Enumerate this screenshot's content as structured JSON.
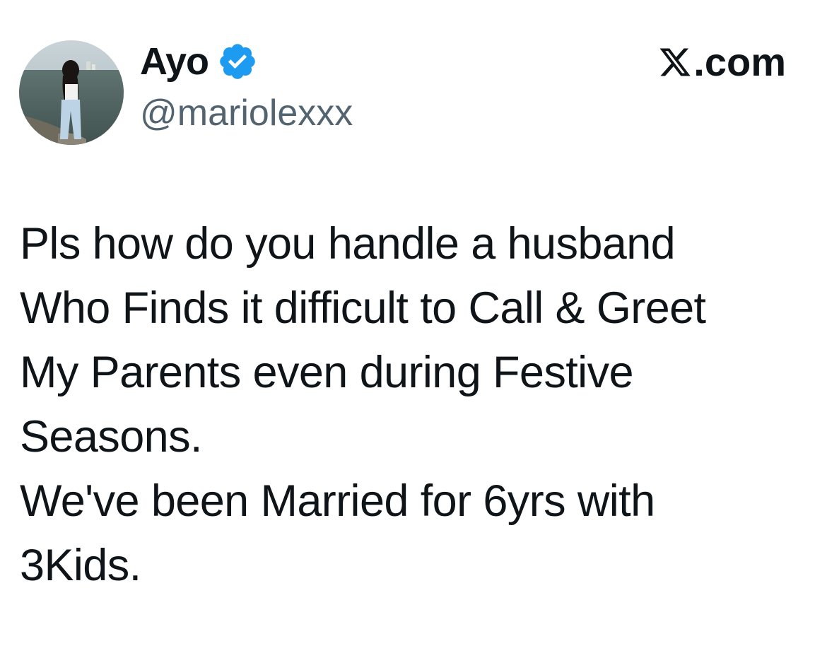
{
  "author": {
    "display_name": "Ayo",
    "handle": "@mariolexxx",
    "verified": true,
    "avatar_icon": "profile-photo-woman-by-sea"
  },
  "brand": {
    "text": ".com",
    "logo_icon": "x-logo-icon"
  },
  "tweet": {
    "lines": [
      "Pls how do you handle a husband",
      "Who Finds it difficult to Call & Greet",
      "My Parents even during Festive",
      "Seasons.",
      "We've been Married for 6yrs with",
      "3Kids."
    ]
  },
  "colors": {
    "text": "#0f1419",
    "secondary": "#536471",
    "verified_blue": "#1d9bf0",
    "background": "#ffffff"
  }
}
